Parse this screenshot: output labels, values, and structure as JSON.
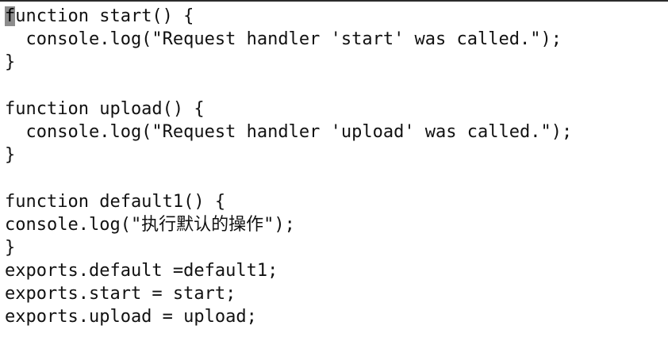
{
  "editor": {
    "cursor_char": "f",
    "lines": [
      "unction start() {",
      "  console.log(\"Request handler 'start' was called.\");",
      "}",
      "",
      "function upload() {",
      "  console.log(\"Request handler 'upload' was called.\");",
      "}",
      "",
      "function default1() {",
      "console.log(\"执行默认的操作\");",
      "}",
      "exports.default =default1;",
      "exports.start = start;",
      "exports.upload = upload;"
    ]
  }
}
